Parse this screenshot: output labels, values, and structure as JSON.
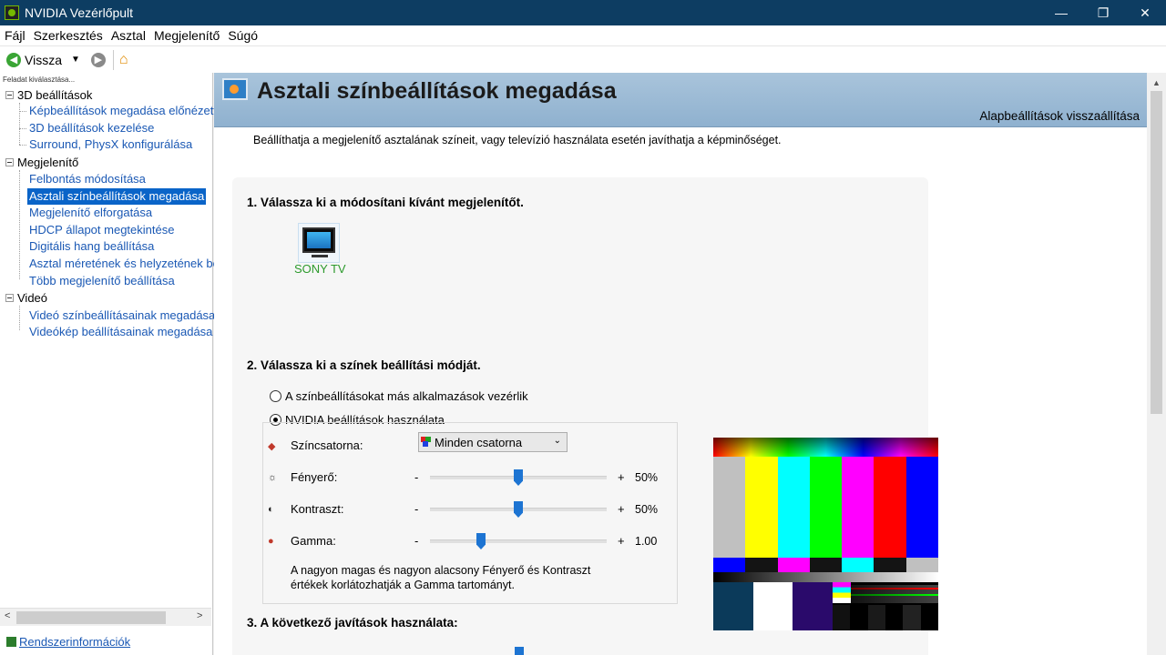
{
  "window": {
    "title": "NVIDIA Vezérlőpult",
    "controls": {
      "minimize": "—",
      "maximize": "❐",
      "close": "✕"
    }
  },
  "menu": [
    "Fájl",
    "Szerkesztés",
    "Asztal",
    "Megjelenítő",
    "Súgó"
  ],
  "toolbar": {
    "back_label": "Vissza",
    "back_glyph": "◀",
    "caret": "▼",
    "forward_glyph": "▶",
    "home_glyph": "⌂"
  },
  "sidebar": {
    "header": "Feladat kiválasztása...",
    "categories": [
      {
        "label": "3D beállítások",
        "items": [
          "Képbeállítások megadása előnézettel",
          "3D beállítások kezelése",
          "Surround, PhysX konfigurálása"
        ]
      },
      {
        "label": "Megjelenítő",
        "items": [
          "Felbontás módosítása",
          "Asztali színbeállítások megadása",
          "Megjelenítő elforgatása",
          "HDCP állapot megtekintése",
          "Digitális hang beállítása",
          "Asztal méretének és helyzetének be",
          "Több megjelenítő beállítása"
        ]
      },
      {
        "label": "Videó",
        "items": [
          "Videó színbeállításainak megadása",
          "Videókép beállításainak megadása"
        ]
      }
    ],
    "selected": "Asztali színbeállítások megadása",
    "scroll_left": "<",
    "scroll_right": ">",
    "system_info": "Rendszerinformációk"
  },
  "page": {
    "title": "Asztali színbeállítások megadása",
    "reset_link": "Alapbeállítások visszaállítása",
    "description": "Beállíthatja a megjelenítő asztalának színeit, vagy televízió használata esetén javíthatja a képminőséget.",
    "step1": "1. Válassza ki a módosítani kívánt megjelenítőt.",
    "display_name": "SONY TV",
    "step2": "2. Válassza ki a színek beállítási módját.",
    "radio_other": "A színbeállításokat más alkalmazások vezérlik",
    "radio_nvidia": "NVIDIA beállítások használata",
    "radio_selected": "nvidia",
    "channel": {
      "label": "Színcsatorna:",
      "value": "Minden csatorna",
      "chevron": "⌄"
    },
    "sliders": [
      {
        "icon": "☼",
        "label": "Fényerő:",
        "minus": "-",
        "plus": "+",
        "value_text": "50%",
        "value": 0.5
      },
      {
        "icon": "◐",
        "label": "Kontraszt:",
        "minus": "-",
        "plus": "+",
        "value_text": "50%",
        "value": 0.5
      },
      {
        "icon": "●",
        "label": "Gamma:",
        "minus": "-",
        "plus": "+",
        "value_text": "1.00",
        "value": 0.29
      }
    ],
    "note": "A nagyon magas és nagyon alacsony Fényerő és Kontraszt értékek korlátozhatják a Gamma tartományt.",
    "step3": "3. A következő javítások használata:"
  },
  "colors": {
    "titlebar": "#0d3d62",
    "accent": "#0a64c8",
    "link": "#1a58b4",
    "display_label": "#2c9a2c",
    "test_bars": [
      "#c0c0c0",
      "#ffff00",
      "#00ffff",
      "#00ff00",
      "#ff00ff",
      "#ff0000",
      "#0000ff"
    ],
    "test_reverse": [
      "#0000ff",
      "#141414",
      "#ff00ff",
      "#141414",
      "#00ffff",
      "#141414",
      "#c0c0c0"
    ],
    "test_pluge": [
      "#111111",
      "#000000",
      "#1a1a1a",
      "#000000",
      "#222222",
      "#000000"
    ]
  }
}
